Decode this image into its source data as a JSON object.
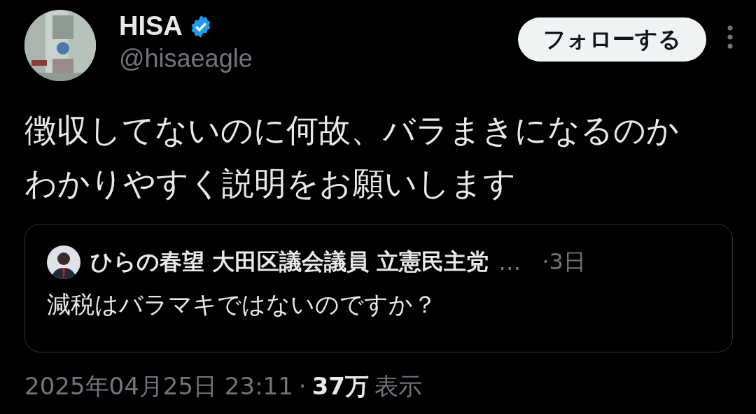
{
  "author": {
    "name": "HISA",
    "verified": true,
    "handle": "@hisaeagle"
  },
  "follow_button": "フォローする",
  "text_lines": [
    "徴収してないのに何故、バラまきになるのか",
    "わかりやすく説明をお願いします"
  ],
  "quote": {
    "author": "ひらの春望 大田区議会議員 立憲民主党",
    "ellipsis": "…",
    "time": "·3日",
    "text": "減税はバラマキではないのですか？"
  },
  "footer": {
    "timestamp": "2025年04月25日 23:11",
    "separator": "·",
    "views": "37万",
    "views_label": "表示"
  }
}
